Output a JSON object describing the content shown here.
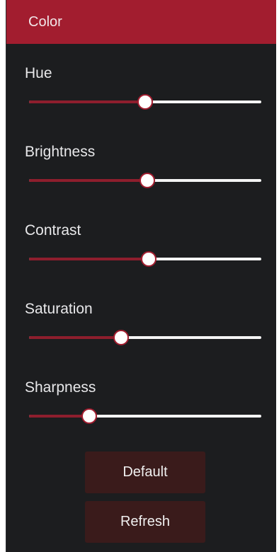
{
  "panel": {
    "title": "Color"
  },
  "sliders": [
    {
      "label": "Hue",
      "value": 0.5
    },
    {
      "label": "Brightness",
      "value": 0.51
    },
    {
      "label": "Contrast",
      "value": 0.515
    },
    {
      "label": "Saturation",
      "value": 0.395
    },
    {
      "label": "Sharpness",
      "value": 0.26
    }
  ],
  "buttons": {
    "default_label": "Default",
    "refresh_label": "Refresh"
  },
  "colors": {
    "header_bg": "#a21d2f",
    "panel_bg": "#1c1d1f",
    "slider_fill": "#8e1e2d",
    "slider_track": "#f4f4f4",
    "button_bg": "#3a1b1b"
  }
}
